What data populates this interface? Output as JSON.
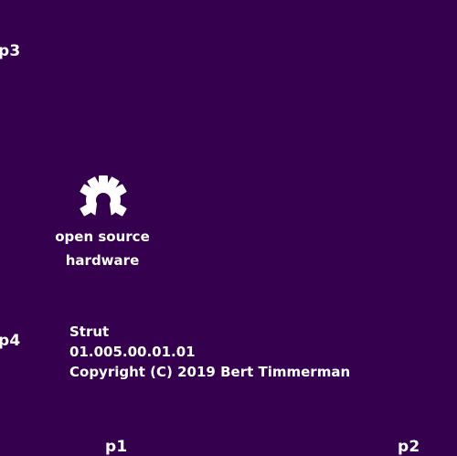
{
  "colors": {
    "background": "#35004d",
    "foreground": "#ffffff"
  },
  "pads": {
    "p1": "p1",
    "p2": "p2",
    "p3": "p3",
    "p4": "p4"
  },
  "logo": {
    "icon": "open-source-hardware-gear-icon",
    "line1": "open source",
    "line2": "hardware"
  },
  "info": {
    "name": "Strut",
    "version": "01.005.00.01.01",
    "copyright": "Copyright (C) 2019 Bert Timmerman"
  }
}
